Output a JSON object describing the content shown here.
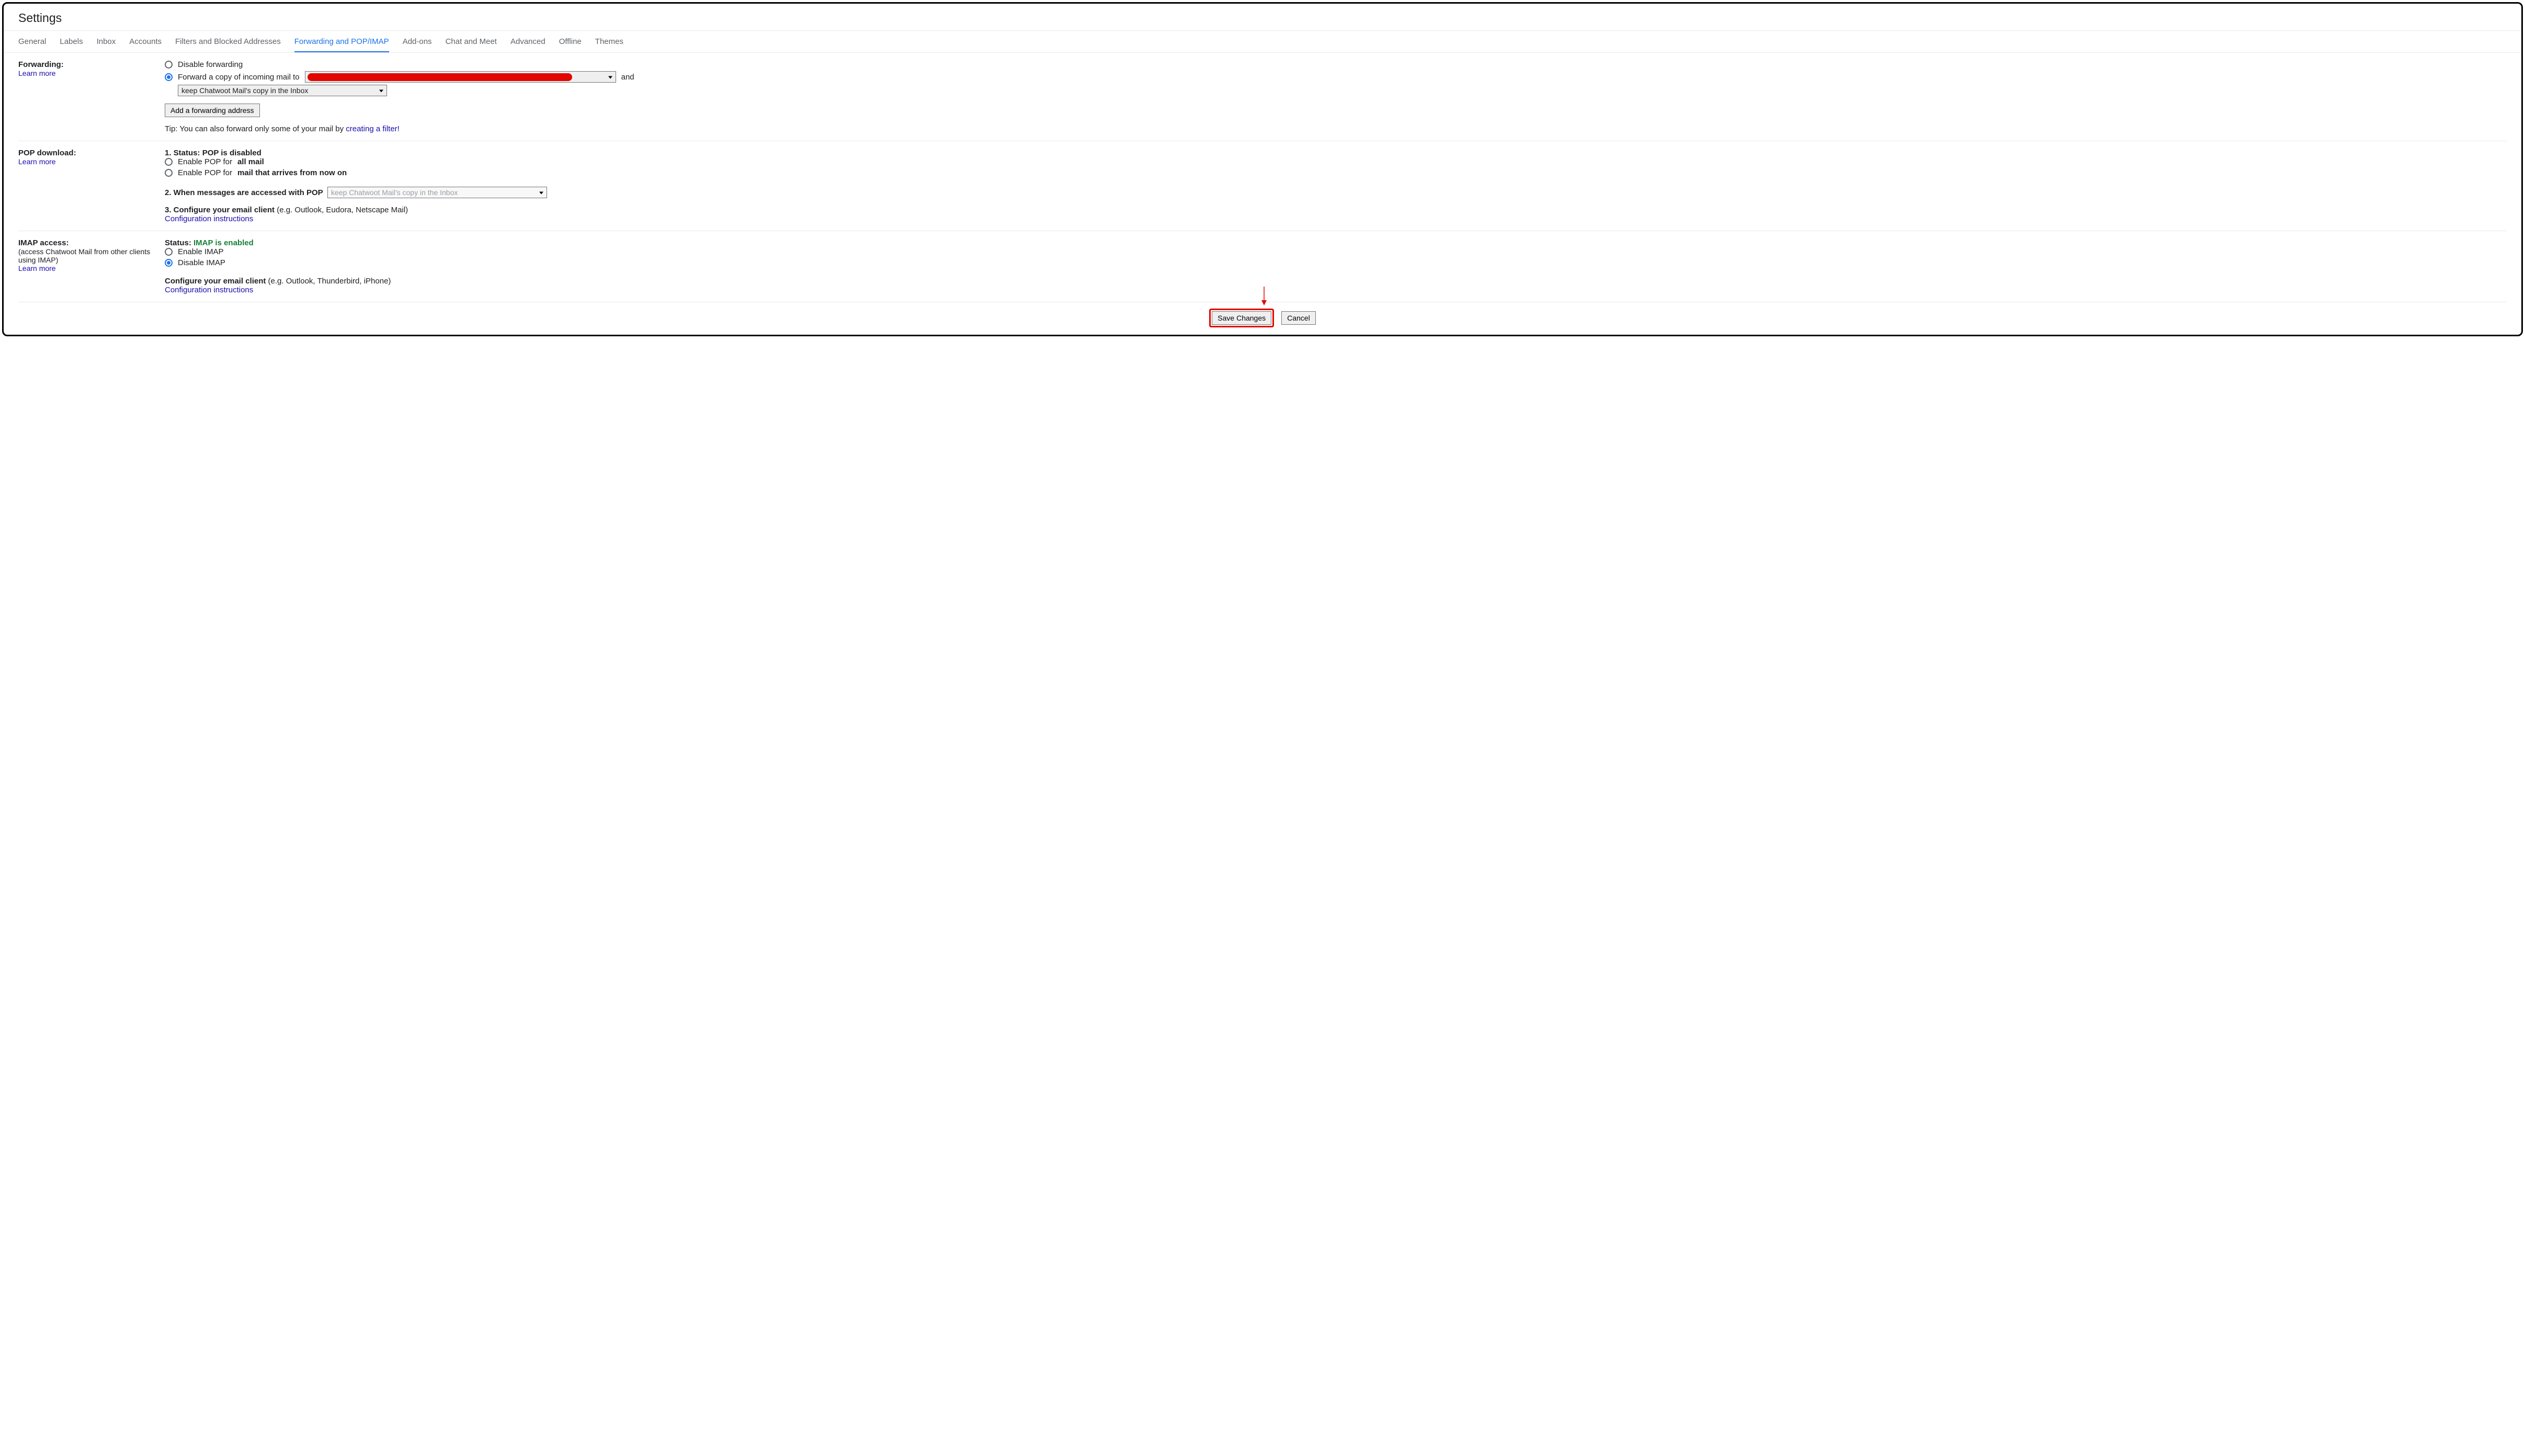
{
  "title": "Settings",
  "tabs": [
    "General",
    "Labels",
    "Inbox",
    "Accounts",
    "Filters and Blocked Addresses",
    "Forwarding and POP/IMAP",
    "Add-ons",
    "Chat and Meet",
    "Advanced",
    "Offline",
    "Themes"
  ],
  "forwarding": {
    "heading": "Forwarding:",
    "learn": "Learn more",
    "disable": "Disable forwarding",
    "forward_prefix": "Forward a copy of incoming mail to",
    "and": "and",
    "keep_option": "keep Chatwoot Mail's copy in the Inbox",
    "add_btn": "Add a forwarding address",
    "tip_prefix": "Tip: You can also forward only some of your mail by ",
    "tip_link": "creating a filter!"
  },
  "pop": {
    "heading": "POP download:",
    "learn": "Learn more",
    "status_prefix": "1. Status: ",
    "status_value": "POP is disabled",
    "enable_all_prefix": "Enable POP for ",
    "enable_all_bold": "all mail",
    "enable_now_prefix": "Enable POP for ",
    "enable_now_bold": "mail that arrives from now on",
    "when_label": "2. When messages are accessed with POP",
    "when_option": "keep Chatwoot Mail's copy in the Inbox",
    "configure_bold": "3. Configure your email client",
    "configure_rest": " (e.g. Outlook, Eudora, Netscape Mail)",
    "config_link": "Configuration instructions"
  },
  "imap": {
    "heading": "IMAP access:",
    "sub": "(access Chatwoot Mail from other clients using IMAP)",
    "learn": "Learn more",
    "status_prefix": "Status: ",
    "status_value": "IMAP is enabled",
    "enable": "Enable IMAP",
    "disable": "Disable IMAP",
    "configure_bold": "Configure your email client",
    "configure_rest": " (e.g. Outlook, Thunderbird, iPhone)",
    "config_link": "Configuration instructions"
  },
  "footer": {
    "save": "Save Changes",
    "cancel": "Cancel"
  }
}
